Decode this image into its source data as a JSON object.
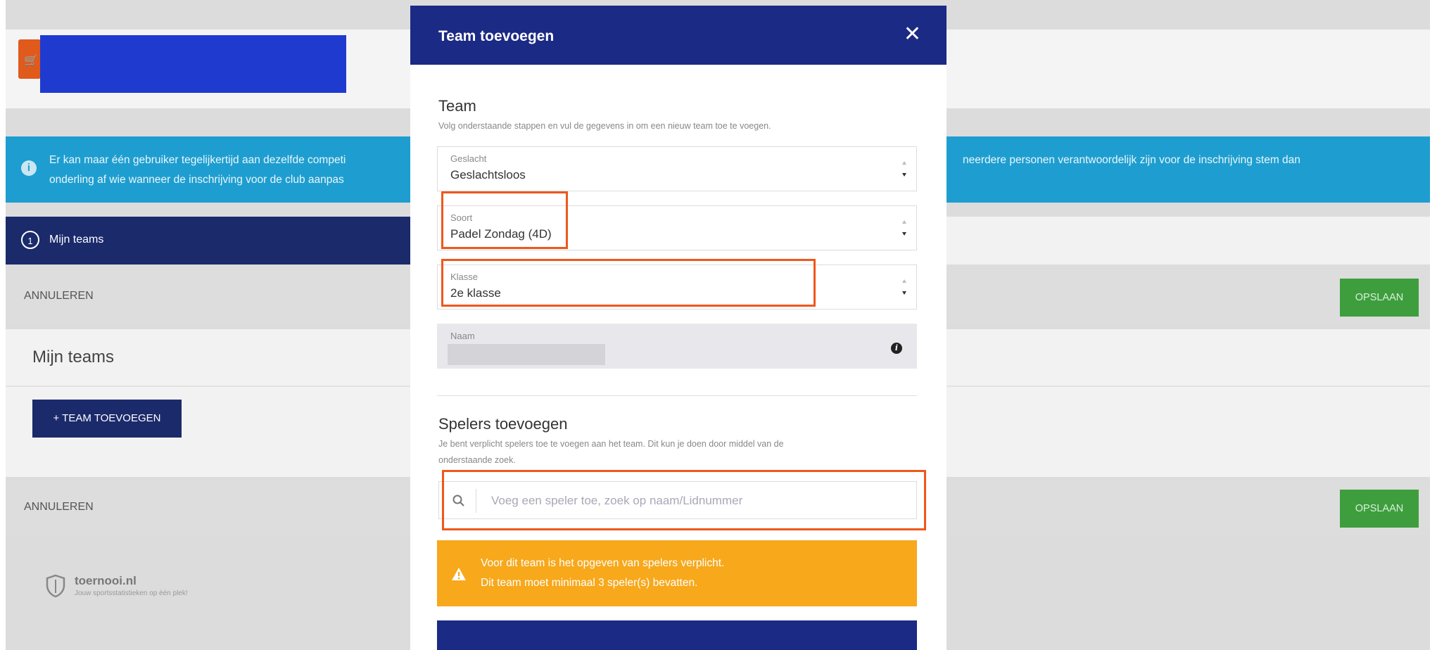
{
  "background": {
    "info": {
      "left_text_line1": "Er kan maar één gebruiker tegelijkertijd aan dezelfde competi",
      "left_text_line2": "onderling af wie wanneer de inschrijving voor de club aanpas",
      "right_text_line1": "neerdere personen verantwoordelijk zijn voor de inschrijving stem dan"
    },
    "step": {
      "number": "1",
      "label": "Mijn teams"
    },
    "actions": {
      "cancel_label": "ANNULEREN",
      "save_label": "OPSLAAN"
    },
    "teams": {
      "title": "Mijn teams",
      "add_button_label": "+ TEAM TOEVOEGEN"
    },
    "footer": {
      "brand": "toernooi.nl",
      "tagline": "Jouw sportsstatistieken op één plek!"
    }
  },
  "modal": {
    "title": "Team toevoegen",
    "team_section": {
      "title": "Team",
      "subtitle": "Volg onderstaande stappen en vul de gegevens in om een nieuw team toe te voegen."
    },
    "fields": {
      "geslacht": {
        "label": "Geslacht",
        "value": "Geslachtsloos"
      },
      "soort": {
        "label": "Soort",
        "value": "Padel Zondag (4D)"
      },
      "klasse": {
        "label": "Klasse",
        "value": "2e klasse"
      },
      "naam": {
        "label": "Naam",
        "value": ""
      }
    },
    "players_section": {
      "title": "Spelers toevoegen",
      "subtitle_line1": "Je bent verplicht spelers toe te voegen aan het team. Dit kun je doen door middel van de",
      "subtitle_line2": "onderstaande zoek.",
      "search_placeholder": "Voeg een speler toe, zoek op naam/Lidnummer"
    },
    "warning": {
      "line1": "Voor dit team is het opgeven van spelers verplicht.",
      "line2": "Dit team moet minimaal 3 speler(s) bevatten."
    }
  },
  "colors": {
    "modal_header": "#1b2a85",
    "info_bar": "#1e9ed0",
    "save_button": "#3e9e3e",
    "warning": "#f7a81b",
    "highlight": "#f0571b",
    "redaction": "#1f3bcf"
  },
  "icons": [
    "cart-icon",
    "info-icon",
    "close-icon",
    "sort-arrows-icon",
    "search-icon",
    "warning-icon",
    "shield-logo-icon"
  ]
}
